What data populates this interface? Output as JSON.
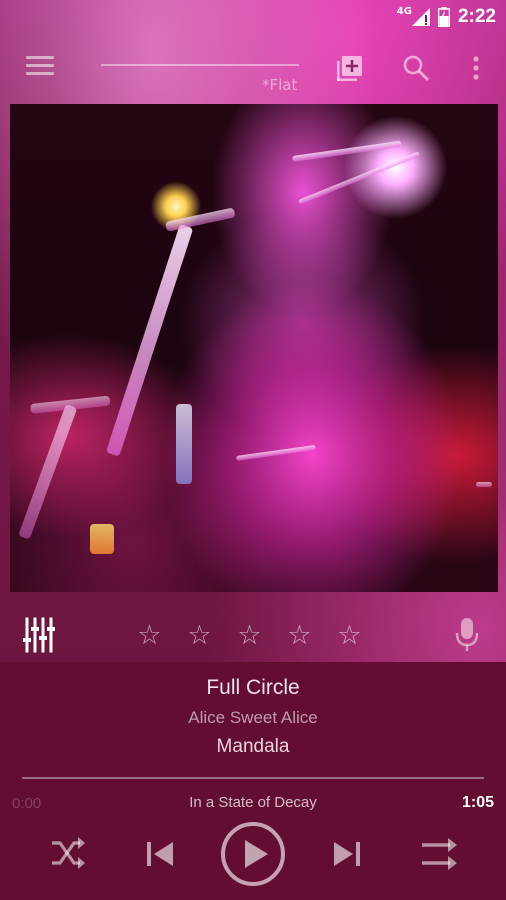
{
  "status_bar": {
    "network": "4G",
    "time": "2:22"
  },
  "toolbar": {
    "preset_label": "*Flat"
  },
  "rating": {
    "stars": 5,
    "filled": 0
  },
  "track": {
    "title": "Full Circle",
    "artist": "Alice Sweet Alice",
    "album": "Mandala"
  },
  "playback": {
    "elapsed": "0:00",
    "total": "1:05",
    "next_song": "In a State of Decay",
    "progress": 0
  },
  "colors": {
    "panel": "#630d33",
    "accent": "#ff4fd2"
  },
  "icons": {
    "menu": "menu-icon",
    "add_to_queue": "add-to-playlist-icon",
    "search": "search-icon",
    "more": "more-vert-icon",
    "equalizer": "equalizer-icon",
    "voice": "mic-icon",
    "shuffle": "shuffle-icon",
    "previous": "skip-previous-icon",
    "play": "play-icon",
    "next": "skip-next-icon",
    "repeat": "repeat-icon"
  }
}
